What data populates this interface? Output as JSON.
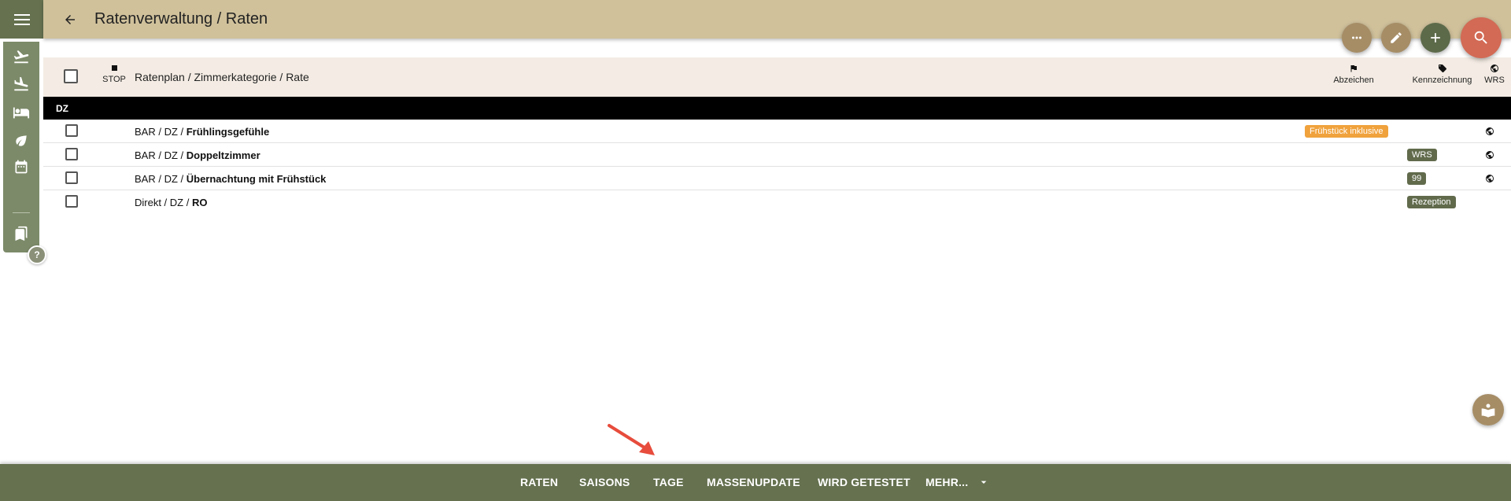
{
  "header": {
    "title": "Ratenverwaltung / Raten"
  },
  "sidebar": {
    "items": [
      {
        "icon": "flight-takeoff-icon"
      },
      {
        "icon": "flight-land-icon"
      },
      {
        "icon": "bed-icon"
      },
      {
        "icon": "leaf-icon"
      },
      {
        "icon": "calendar-icon"
      },
      {
        "icon": "bookmarks-icon"
      }
    ],
    "help_label": "?"
  },
  "actions": {
    "more_icon": "more-horiz-icon",
    "edit_icon": "edit-icon",
    "add_icon": "add-icon",
    "search_icon": "search-icon"
  },
  "table": {
    "columns": {
      "stop": "STOP",
      "name": "Ratenplan / Zimmerkategorie / Rate",
      "abzeichen": "Abzeichen",
      "kennzeichnung": "Kennzeichnung",
      "wrs": "WRS"
    },
    "group": "DZ",
    "rows": [
      {
        "prefix": "BAR / DZ / ",
        "rate": "Frühlingsgefühle",
        "abzeichen": "Frühstück inklusive",
        "kennzeichnung": "",
        "wrs": true
      },
      {
        "prefix": "BAR / DZ / ",
        "rate": "Doppeltzimmer",
        "abzeichen": "",
        "kennzeichnung": "WRS",
        "wrs": true
      },
      {
        "prefix": "BAR / DZ / ",
        "rate": "Übernachtung mit Frühstück",
        "abzeichen": "",
        "kennzeichnung": "99",
        "wrs": true
      },
      {
        "prefix": "Direkt / DZ / ",
        "rate": "RO",
        "abzeichen": "",
        "kennzeichnung": "Rezeption",
        "wrs": false
      }
    ]
  },
  "bottom_tabs": {
    "raten": "RATEN",
    "saisons": "SAISONS",
    "tage": "TAGE",
    "massenupdate": "MASSENUPDATE",
    "wird_getestet": "WIRD GETESTET",
    "mehr": "MEHR..."
  },
  "colors": {
    "header": "#d0c19b",
    "sidebar": "#7c8a69",
    "bottom_bar": "#65714f",
    "badge_orange": "#f0a23c",
    "badge_green": "#616b4c",
    "search_fab": "#d26a55",
    "arrow": "#e74c3c"
  }
}
